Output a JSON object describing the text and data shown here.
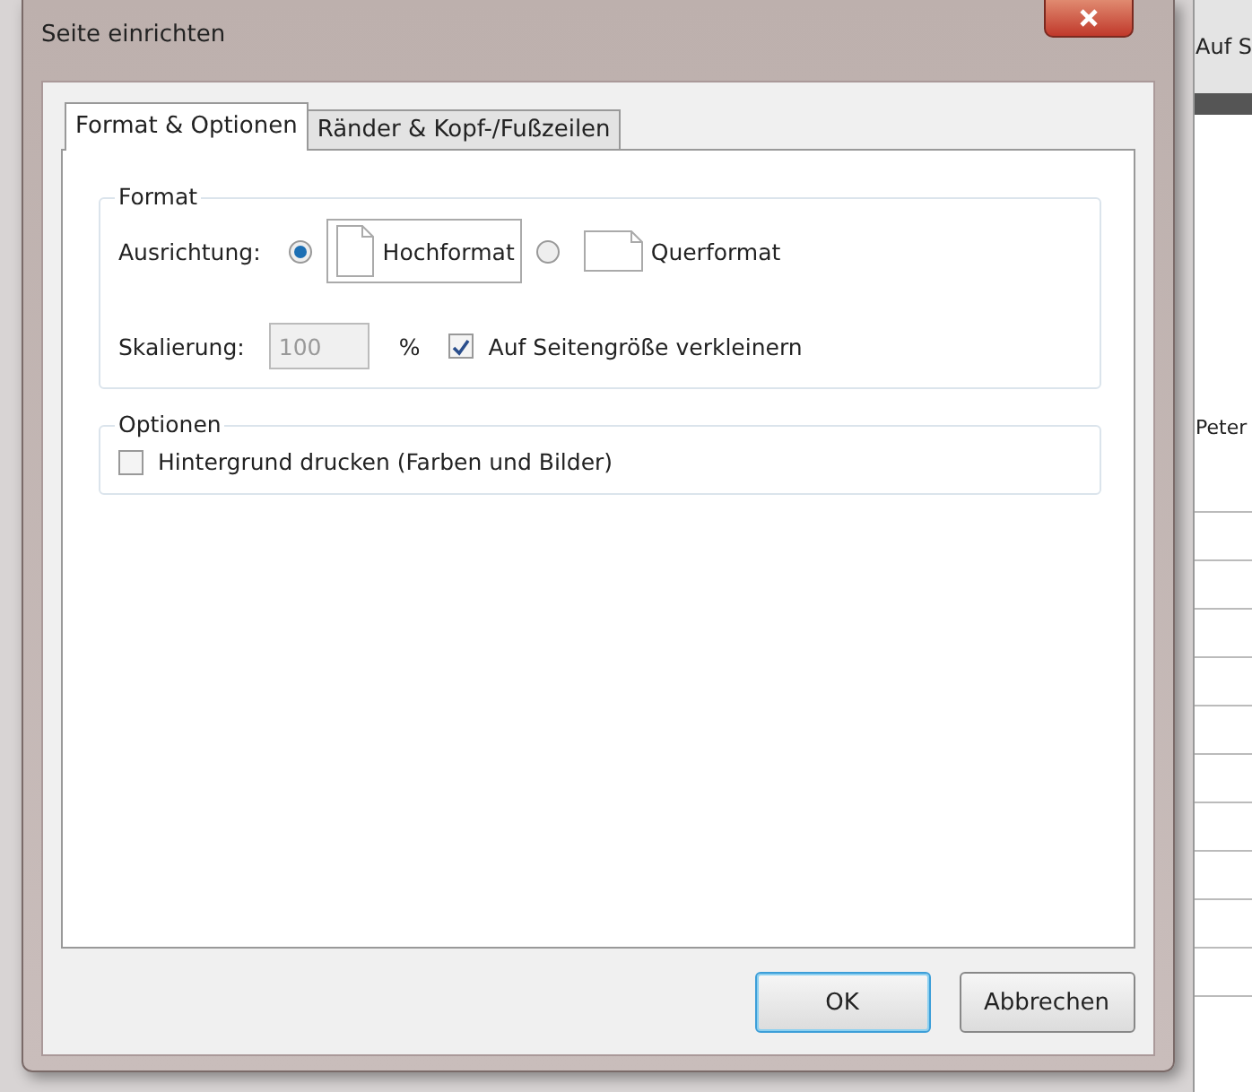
{
  "window": {
    "title": "Seite einrichten"
  },
  "tabs": [
    {
      "label": "Format & Optionen",
      "selected": true
    },
    {
      "label": "Ränder & Kopf-/Fußzeilen",
      "selected": false
    }
  ],
  "format_group": {
    "legend": "Format",
    "orientation_label": "Ausrichtung:",
    "orientations": [
      {
        "label": "Hochformat",
        "kind": "portrait",
        "selected": true
      },
      {
        "label": "Querformat",
        "kind": "landscape",
        "selected": false
      }
    ],
    "scaling_label": "Skalierung:",
    "scaling": {
      "value": "100",
      "disabled": true
    },
    "unit": "%",
    "shrink": {
      "label": "Auf Seitengröße verkleinern",
      "checked": true
    }
  },
  "options_group": {
    "legend": "Optionen",
    "background": {
      "label": "Hintergrund drucken (Farben und Bilder)",
      "checked": false
    }
  },
  "buttons": [
    {
      "label": "OK",
      "default": true
    },
    {
      "label": "Abbrechen",
      "default": false
    }
  ],
  "background_window": {
    "header": "Auf S",
    "cell": "Peter"
  }
}
